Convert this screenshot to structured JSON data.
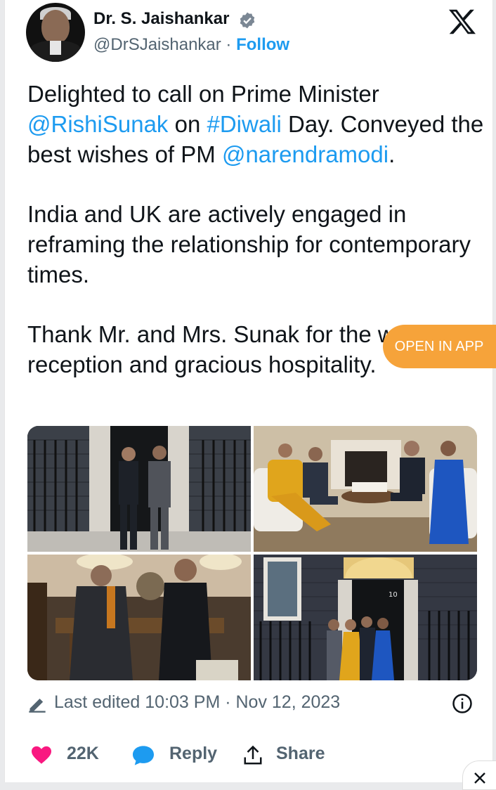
{
  "header": {
    "display_name": "Dr. S. Jaishankar",
    "handle": "@DrSJaishankar",
    "separator": " · ",
    "follow_label": "Follow"
  },
  "tweet": {
    "p1_pre": "Delighted to call on Prime Minister ",
    "p1_mention1": "@RishiSunak",
    "p1_mid": " on ",
    "p1_hashtag": "#Diwali",
    "p1_post": " Day. Conveyed the best wishes of PM ",
    "p1_mention2": "@narendramodi",
    "p1_end": ".",
    "p2": "India and UK are actively engaged in reframing the relationship for contemporary times.",
    "p3": "Thank Mr. and Mrs. Sunak for the warm reception and gracious hospitality."
  },
  "open_in_app": "OPEN IN APP",
  "media": {
    "door_number": "10"
  },
  "meta": {
    "last_edited": "Last edited 10:03 PM · Nov 12, 2023"
  },
  "actions": {
    "likes": "22K",
    "reply_label": "Reply",
    "share_label": "Share"
  },
  "colors": {
    "accent": "#1d9bf0",
    "like": "#f91880",
    "open_app": "#f6a33a",
    "muted": "#536471"
  },
  "icons": [
    "verified-badge-icon",
    "x-logo-icon",
    "pencil-icon",
    "info-icon",
    "heart-icon",
    "reply-bubble-icon",
    "share-icon",
    "close-icon"
  ]
}
